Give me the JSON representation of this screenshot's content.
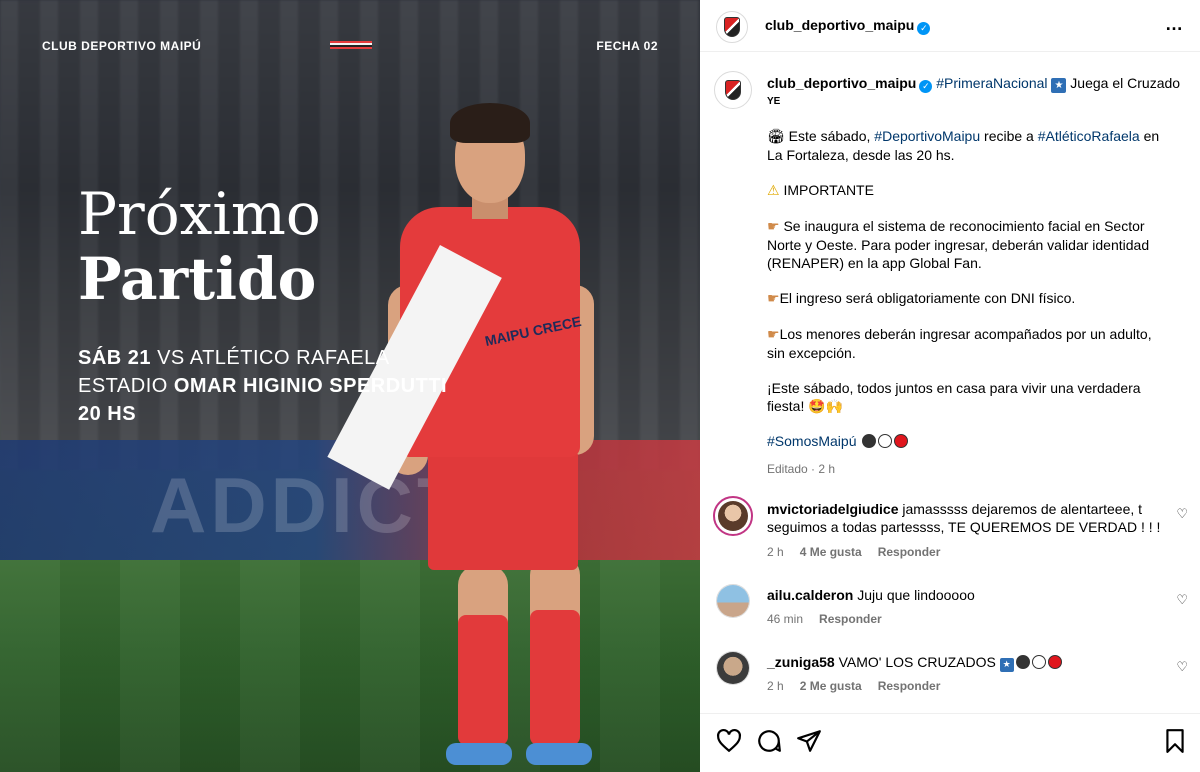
{
  "image": {
    "top_left": "CLUB DEPORTIVO MAIPÚ",
    "top_right": "FECHA 02",
    "title_line1": "Próximo",
    "title_line2": "Partido",
    "match_line1_bold": "SÁB 21",
    "match_line1_rest": " VS ATLÉTICO RAFAELA",
    "match_line2_prefix": "ESTADIO ",
    "match_line2_bold": "OMAR HIGINIO SPERDUTTI",
    "match_line3": "20 HS",
    "banner_text": "ADDICT",
    "sponsor_text": "MAIPU CRECE",
    "colors": {
      "red": "#e43b3c",
      "white": "#f4f4f4",
      "black": "#222222"
    }
  },
  "header": {
    "username": "club_deportivo_maipu",
    "more_icon": "…"
  },
  "caption": {
    "username": "club_deportivo_maipu",
    "hashtag_primera": "#PrimeraNacional",
    "after_hashtag": " Juega el Cruzado",
    "sub": "YE",
    "p1_prefix": " Este sábado, ",
    "p1_hashtag1": "#DeportivoMaipu",
    "p1_mid": " recibe a ",
    "p1_hashtag2": "#AtléticoRafaela",
    "p1_suffix": " en La Fortaleza, desde las 20 hs.",
    "p2": " IMPORTANTE",
    "p3": " Se inaugura el sistema de reconocimiento facial en Sector Norte y Oeste. Para poder ingresar, deberán validar identidad (RENAPER) en la app Global Fan.",
    "p4": "El ingreso será obligatoriamente con DNI físico.",
    "p5": "Los menores deberán ingresar acompañados por un adulto, sin excepción.",
    "p6": "¡Este sábado, todos juntos en casa para vivir una verdadera fiesta! 🤩🙌",
    "p7_hashtag": "#SomosMaipú",
    "edited": "Editado · 2 h"
  },
  "comments": [
    {
      "username": "mvictoriadelgiudice",
      "text": " jamasssss dejaremos de alentarteee, t seguimos a todas partessss, TE QUEREMOS DE VERDAD ! ! !",
      "time": "2 h",
      "likes": "4 Me gusta",
      "reply": "Responder"
    },
    {
      "username": "ailu.calderon",
      "text": " Juju que lindooooo",
      "time": "46 min",
      "likes": "",
      "reply": "Responder"
    },
    {
      "username": "_zuniga58",
      "text": " VAMO' LOS CRUZADOS ",
      "time": "2 h",
      "likes": "2 Me gusta",
      "reply": "Responder"
    }
  ],
  "actions": {
    "like_icon": "heart-icon",
    "comment_icon": "comment-icon",
    "share_icon": "share-icon",
    "save_icon": "bookmark-icon"
  }
}
